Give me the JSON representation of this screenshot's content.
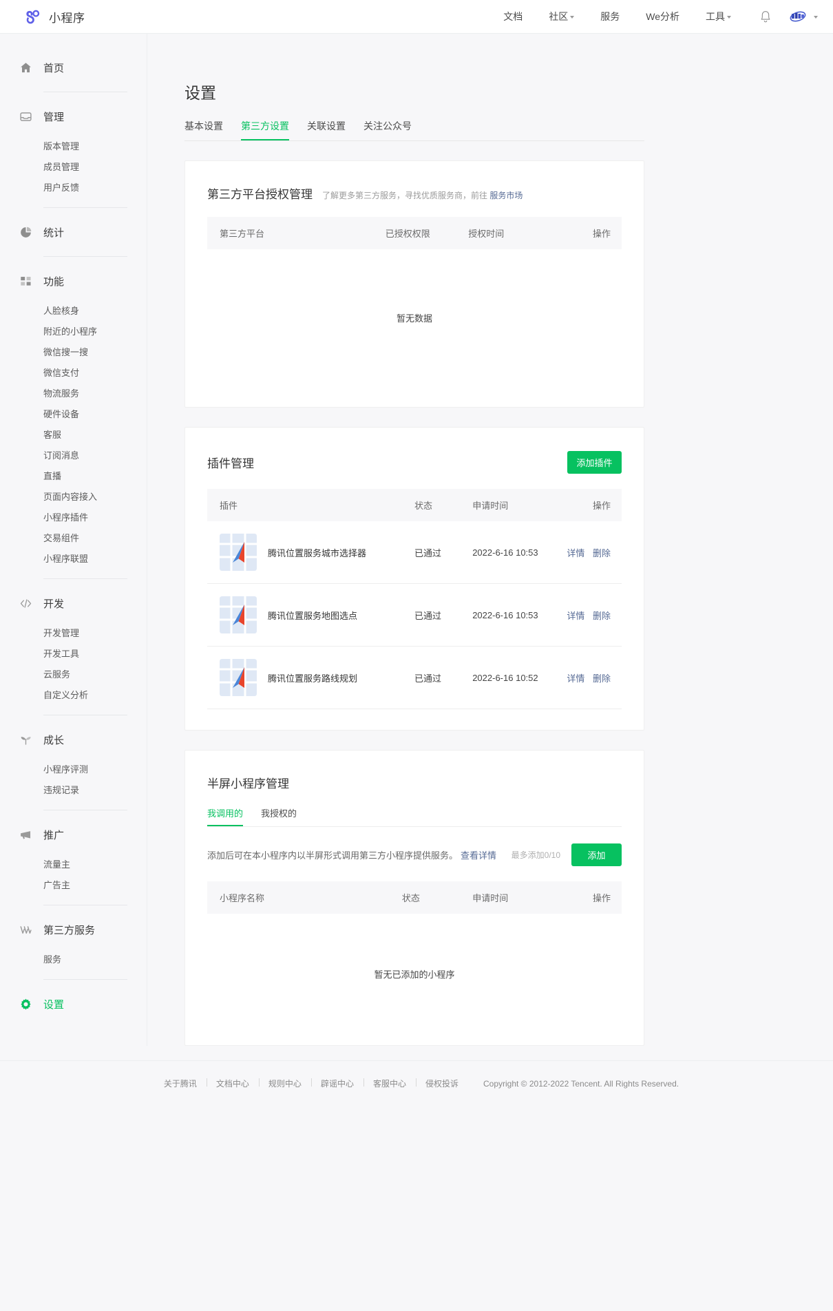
{
  "brand": {
    "name": "小程序",
    "logo_color": "#5f60e8"
  },
  "topnav": {
    "items": [
      {
        "label": "文档",
        "has_caret": false
      },
      {
        "label": "社区",
        "has_caret": true
      },
      {
        "label": "服务",
        "has_caret": false
      },
      {
        "label": "We分析",
        "has_caret": false
      },
      {
        "label": "工具",
        "has_caret": true
      }
    ],
    "bell_icon": "bell-icon",
    "avatar_icon": "avatar",
    "user_caret": true
  },
  "sidebar": {
    "groups": [
      {
        "icon": "home-icon",
        "label": "首页",
        "active": false,
        "children": []
      },
      {
        "icon": "inbox-icon",
        "label": "管理",
        "active": false,
        "children": [
          "版本管理",
          "成员管理",
          "用户反馈"
        ]
      },
      {
        "icon": "pie-chart-icon",
        "label": "统计",
        "active": false,
        "children": []
      },
      {
        "icon": "grid-icon",
        "label": "功能",
        "active": false,
        "children": [
          "人脸核身",
          "附近的小程序",
          "微信搜一搜",
          "微信支付",
          "物流服务",
          "硬件设备",
          "客服",
          "订阅消息",
          "直播",
          "页面内容接入",
          "小程序插件",
          "交易组件",
          "小程序联盟"
        ]
      },
      {
        "icon": "code-icon",
        "label": "开发",
        "active": false,
        "children": [
          "开发管理",
          "开发工具",
          "云服务",
          "自定义分析"
        ]
      },
      {
        "icon": "sprout-icon",
        "label": "成长",
        "active": false,
        "children": [
          "小程序评测",
          "违规记录"
        ]
      },
      {
        "icon": "megaphone-icon",
        "label": "推广",
        "active": false,
        "children": [
          "流量主",
          "广告主"
        ]
      },
      {
        "icon": "thirdparty-icon",
        "label": "第三方服务",
        "active": false,
        "children": [
          "服务"
        ]
      },
      {
        "icon": "gear-icon",
        "label": "设置",
        "active": true,
        "children": []
      }
    ]
  },
  "page": {
    "title": "设置",
    "tabs": [
      {
        "label": "基本设置",
        "active": false
      },
      {
        "label": "第三方设置",
        "active": true
      },
      {
        "label": "关联设置",
        "active": false
      },
      {
        "label": "关注公众号",
        "active": false
      }
    ]
  },
  "third_party_card": {
    "title": "第三方平台授权管理",
    "subtitle": "了解更多第三方服务，寻找优质服务商，前往",
    "sub_link": "服务市场",
    "columns": [
      "第三方平台",
      "已授权权限",
      "授权时间",
      "操作"
    ],
    "rows": [],
    "empty_text": "暂无数据"
  },
  "plugin_card": {
    "title": "插件管理",
    "add_button": "添加插件",
    "columns": [
      "插件",
      "状态",
      "申请时间",
      "操作"
    ],
    "rows": [
      {
        "icon": "map-plugin-icon",
        "name": "腾讯位置服务城市选择器",
        "status": "已通过",
        "time": "2022-6-16 10:53",
        "ops": [
          "详情",
          "删除"
        ]
      },
      {
        "icon": "map-plugin-icon",
        "name": "腾讯位置服务地图选点",
        "status": "已通过",
        "time": "2022-6-16 10:53",
        "ops": [
          "详情",
          "删除"
        ]
      },
      {
        "icon": "map-plugin-icon",
        "name": "腾讯位置服务路线规划",
        "status": "已通过",
        "time": "2022-6-16 10:52",
        "ops": [
          "详情",
          "删除"
        ]
      }
    ]
  },
  "halfscreen_card": {
    "title": "半屏小程序管理",
    "subtabs": [
      {
        "label": "我调用的",
        "active": true
      },
      {
        "label": "我授权的",
        "active": false
      }
    ],
    "notice": "添加后可在本小程序内以半屏形式调用第三方小程序提供服务。",
    "notice_link": "查看详情",
    "quota": "最多添加0/10",
    "add_button": "添加",
    "columns": [
      "小程序名称",
      "状态",
      "申请时间",
      "操作"
    ],
    "rows": [],
    "empty_text": "暂无已添加的小程序"
  },
  "footer": {
    "links": [
      "关于腾讯",
      "文档中心",
      "规则中心",
      "辟谣中心",
      "客服中心",
      "侵权投诉"
    ],
    "copyright": "Copyright © 2012-2022 Tencent. All Rights Reserved."
  },
  "colors": {
    "accent": "#07c160",
    "link": "#576b95",
    "page_bg": "#f7f7f9"
  }
}
